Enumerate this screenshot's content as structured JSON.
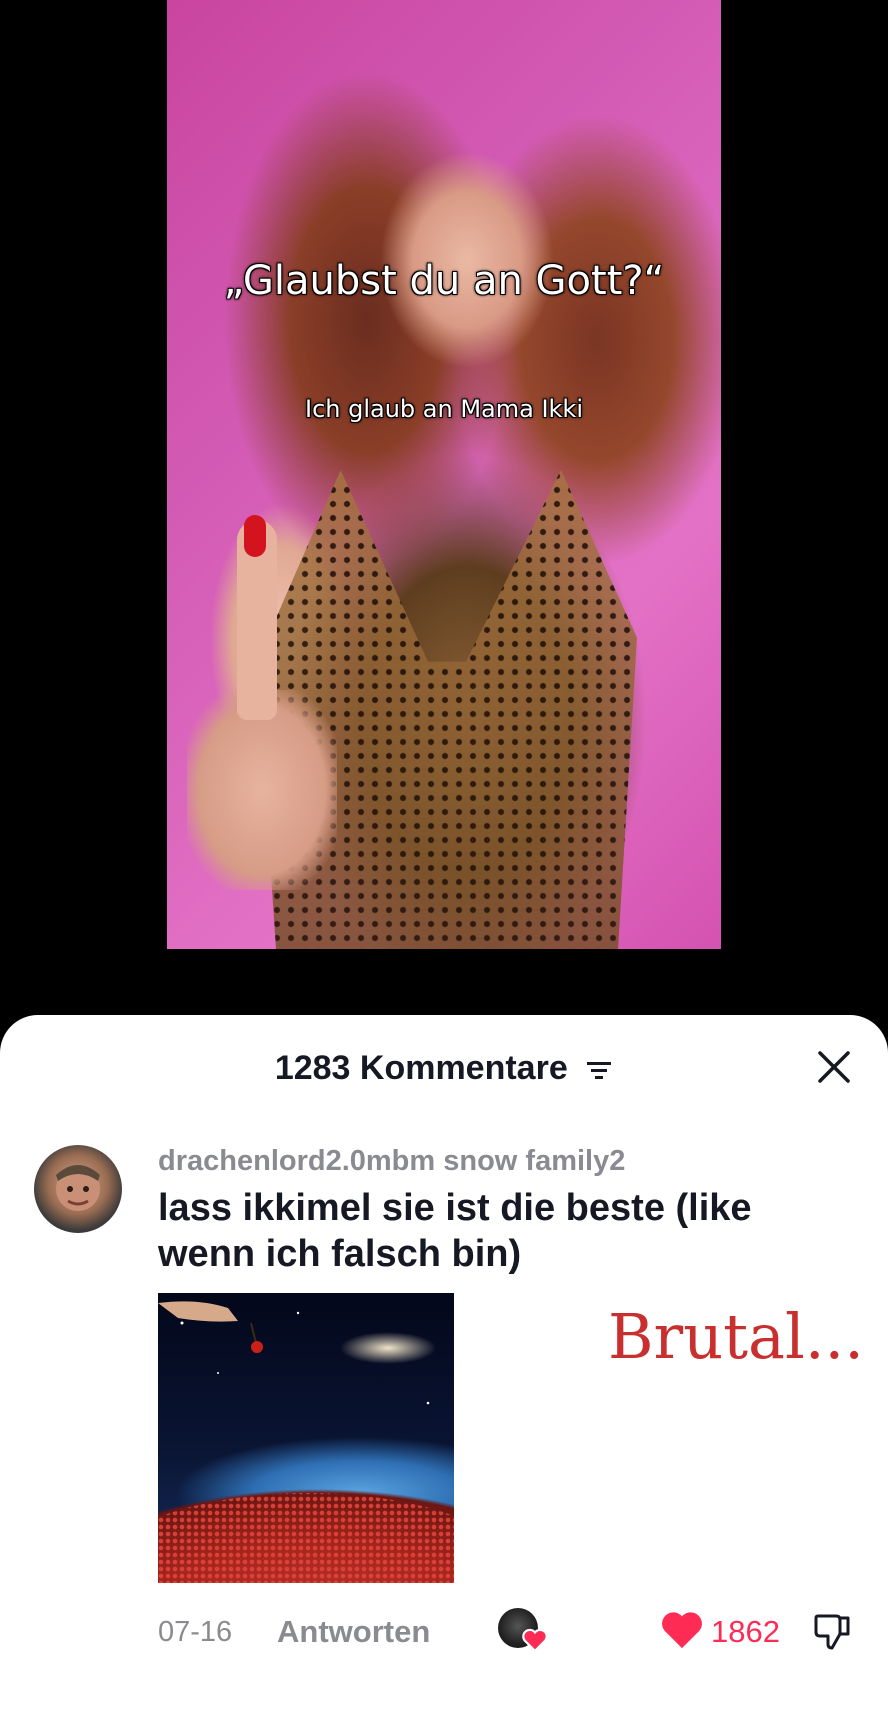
{
  "video": {
    "caption_main": "„Glaubst du an Gott?“",
    "caption_sub": "Ich glaub an Mama Ikki"
  },
  "comments_sheet": {
    "title": "1283 Kommentare",
    "filter_icon": "filter-icon",
    "close_icon": "close-icon"
  },
  "comment": {
    "username": "drachenlord2.0mbm snow family2",
    "text": "lass ikkimel sie ist die beste (like wenn ich falsch bin)",
    "image_overlay_text": "Brutal...",
    "date": "07-16",
    "reply_label": "Antworten",
    "like_count": "1862",
    "like_color": "#fe2c55"
  }
}
